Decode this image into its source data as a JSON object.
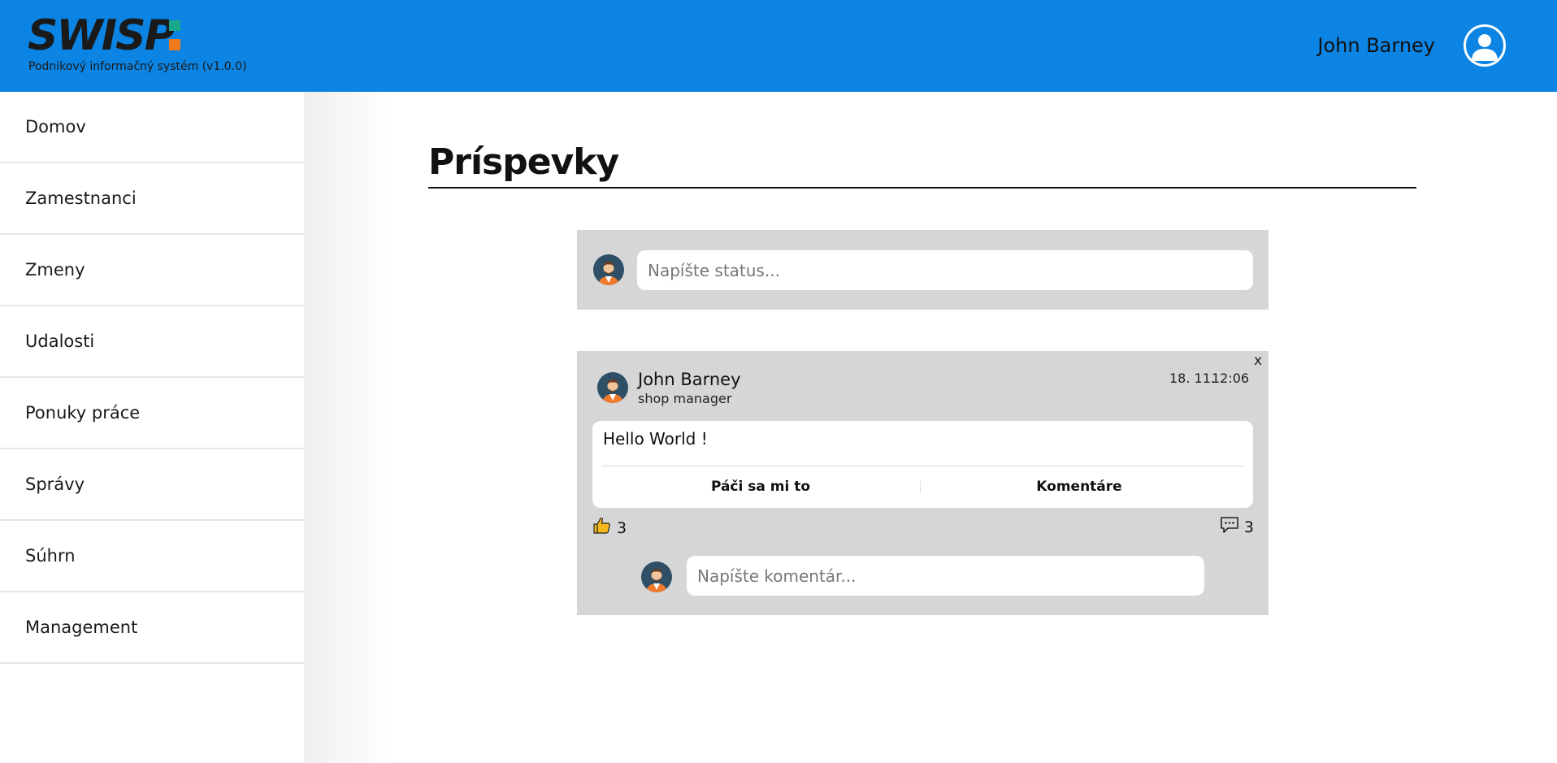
{
  "header": {
    "logo_text": "SWISP",
    "subtitle": "Podnikový informačný systém (v1.0.0)",
    "user_name": "John Barney",
    "brand_color": "#0b84e4",
    "user_icon": "user-circle-icon"
  },
  "sidebar": {
    "items": [
      {
        "label": "Domov"
      },
      {
        "label": "Zamestnanci"
      },
      {
        "label": "Zmeny"
      },
      {
        "label": "Udalosti"
      },
      {
        "label": "Ponuky práce"
      },
      {
        "label": "Správy"
      },
      {
        "label": "Súhrn"
      },
      {
        "label": "Management"
      }
    ]
  },
  "main": {
    "title": "Príspevky",
    "status_placeholder": "Napíšte status...",
    "post": {
      "author": "John Barney",
      "role": "shop manager",
      "date": "18. 11.",
      "time": "12:06",
      "close_label": "x",
      "text": "Hello World !",
      "like_label": "Páči sa mi to",
      "comments_label": "Komentáre",
      "like_count": "3",
      "comment_count": "3",
      "like_icon": "thumbs-up-icon",
      "comment_icon": "comment-bubble-icon",
      "comment_placeholder": "Napíšte komentár..."
    }
  }
}
